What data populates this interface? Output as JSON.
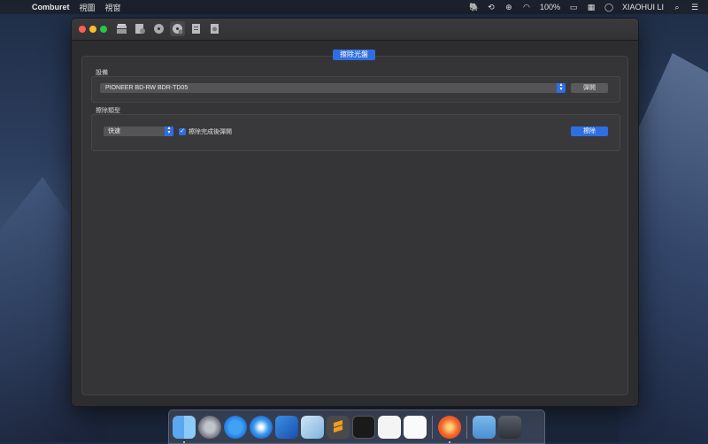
{
  "menubar": {
    "app_name": "Comburet",
    "menus": [
      "視圖",
      "視窗"
    ],
    "battery": "100%",
    "user": "XIAOHUI LI"
  },
  "window": {
    "toolbar_icons": [
      "burn-data-icon",
      "burn-audio-icon",
      "burn-disc-icon",
      "erase-disc-icon",
      "disc-info-icon",
      "disc-image-icon"
    ],
    "tab_title": "擦除光盤",
    "device_section": {
      "label": "設備",
      "selected_device": "PIONEER BD-RW BDR-TD05",
      "eject_button": "彈開"
    },
    "erase_section": {
      "label": "擦除類型",
      "mode": "快速",
      "eject_after_label": "擦除完成後彈開",
      "eject_after_checked": true,
      "erase_button": "擦除"
    }
  },
  "dock": {
    "apps": [
      "finder-icon",
      "launchpad-icon",
      "app-store-icon",
      "safari-icon",
      "xcode-icon",
      "virtualbox-icon",
      "sublime-text-icon",
      "terminal-icon",
      "reminders-icon",
      "textedit-icon",
      "comburet-icon",
      "downloads-folder-icon",
      "trash-icon"
    ]
  }
}
